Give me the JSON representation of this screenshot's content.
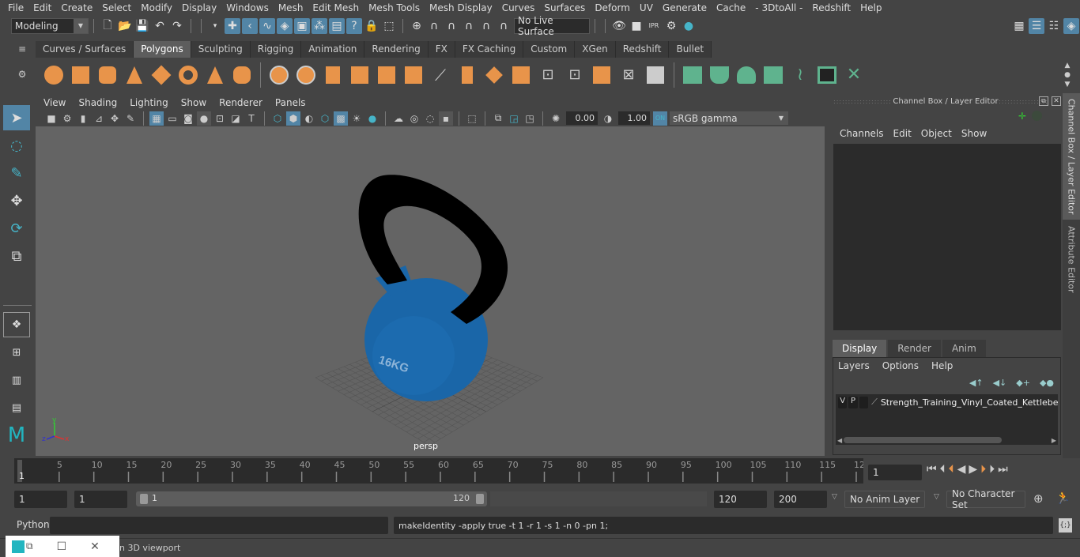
{
  "menubar": {
    "items": [
      "File",
      "Edit",
      "Create",
      "Select",
      "Modify",
      "Display",
      "Windows",
      "Mesh",
      "Edit Mesh",
      "Mesh Tools",
      "Mesh Display",
      "Curves",
      "Surfaces",
      "Deform",
      "UV",
      "Generate",
      "Cache",
      "- 3DtoAll -",
      "Redshift",
      "Help"
    ]
  },
  "statusline": {
    "workspace": "Modeling",
    "live_surface": "No Live Surface"
  },
  "shelf": {
    "tabs": [
      "Curves / Surfaces",
      "Polygons",
      "Sculpting",
      "Rigging",
      "Animation",
      "Rendering",
      "FX",
      "FX Caching",
      "Custom",
      "XGen",
      "Redshift",
      "Bullet"
    ],
    "active_tab": "Polygons"
  },
  "viewport": {
    "menu": [
      "View",
      "Shading",
      "Lighting",
      "Show",
      "Renderer",
      "Panels"
    ],
    "exposure": "0.00",
    "gamma": "1.00",
    "color_space": "sRGB gamma",
    "camera_label": "persp",
    "model_label": "16KG",
    "axis": {
      "x": "x",
      "y": "y",
      "z": "z"
    }
  },
  "channel_box": {
    "title": "Channel Box / Layer Editor",
    "menu": [
      "Channels",
      "Edit",
      "Object",
      "Show"
    ]
  },
  "layer_editor": {
    "tabs": [
      "Display",
      "Render",
      "Anim"
    ],
    "active_tab": "Display",
    "menu": [
      "Layers",
      "Options",
      "Help"
    ],
    "layers": [
      {
        "v": "V",
        "p": "P",
        "name": "Strength_Training_Vinyl_Coated_Kettlebell_"
      }
    ]
  },
  "side_tabs": [
    "Channel Box / Layer Editor",
    "Attribute Editor"
  ],
  "timeline": {
    "ticks": [
      "5",
      "10",
      "15",
      "20",
      "25",
      "30",
      "35",
      "40",
      "45",
      "50",
      "55",
      "60",
      "65",
      "70",
      "75",
      "80",
      "85",
      "90",
      "95",
      "100",
      "105",
      "110",
      "115",
      "12"
    ],
    "current_marker": "1",
    "current_frame": "1"
  },
  "range": {
    "start": "1",
    "playback_start": "1",
    "slider_start": "1",
    "slider_end": "120",
    "playback_end": "120",
    "end": "200",
    "anim_layer": "No Anim Layer",
    "character_set": "No Character Set"
  },
  "command": {
    "language": "Python",
    "input": "",
    "result": "makeIdentity -apply true -t 1 -r 1 -s 1 -n 0 -pn 1;"
  },
  "help_line": {
    "text": "n 3D viewport"
  },
  "colors": {
    "accent": "#5285a6",
    "kettlebell_body": "#1a66a8",
    "handle": "#000000",
    "shelf_orange": "#e8944a",
    "shelf_green": "#5fb38e"
  }
}
